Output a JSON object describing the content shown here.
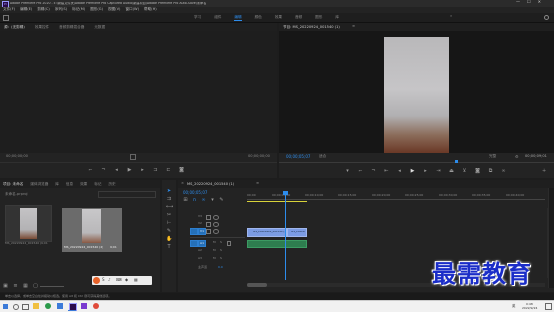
{
  "app": {
    "window_title": "Adobe Premiere Pro 2020 - E:\\新建文件夹\\Adobe Premiere Pro Captured Audio\\新建项目\\Adobe Premiere Pro Auto-Save\\未命名",
    "logo": "Pr",
    "window_controls": [
      "—",
      "☐",
      "✕"
    ]
  },
  "menu": [
    "文件(F)",
    "编辑(E)",
    "剪辑(C)",
    "序列(S)",
    "标记(M)",
    "图形(G)",
    "视图(V)",
    "窗口(W)",
    "帮助(H)"
  ],
  "workspaces": {
    "items": [
      "学习",
      "组件",
      "编辑",
      "颜色",
      "效果",
      "音频",
      "图形",
      "库"
    ],
    "active": "编辑"
  },
  "source_panel": {
    "tabs": [
      "源：(无剪辑)",
      "效果控件",
      "音频剪辑混合器",
      "元数据"
    ],
    "tc_left": "00;00;00;00",
    "tc_right": "00;00;00;00"
  },
  "program_panel": {
    "title": "节目: MS_20220924_001540 (1)",
    "timecode": "00;00;05;07",
    "fit": "适合",
    "quality": "完整",
    "duration": "00;00;09;01",
    "page": "1/2"
  },
  "project_panel": {
    "tabs": [
      "项目: 未命名",
      "媒体浏览器",
      "库",
      "信息",
      "效果",
      "标记",
      "历史"
    ],
    "folder": "未命名.prproj",
    "clips": [
      {
        "name": "MS_20220924_001540 (1)",
        "duration": "9;01",
        "selected": false
      },
      {
        "name": "MS_20220924_001540 (2)",
        "duration": "9;01",
        "selected": true
      }
    ]
  },
  "timeline": {
    "tab": "MS_20220924_001540 (1)",
    "timecode": "00;00;05;07",
    "ruler": [
      "00;00",
      "00;00;05;00",
      "00;00;10;00",
      "00;00;15;00",
      "00;00;20;00",
      "00;00;25;00",
      "00;00;30;00",
      "00;00;35;00",
      "00;00;40;00"
    ],
    "video_tracks": [
      "V3",
      "V2",
      "V1"
    ],
    "audio_tracks": [
      "A1",
      "A2",
      "A3"
    ],
    "master": "主声道",
    "master_value": "0.0",
    "clips": {
      "video_a": "MS_20220924_001540 (1).mp4",
      "video_b": "MS_20220924_001540 (1).mp4"
    }
  },
  "status": {
    "message": "单击以选择，或单击空白处并拖动以框选。使用 Alt 和 Ctrl 键可获得其他选项。"
  },
  "watermark": "最需教育",
  "taskbar": {
    "time": "0:48",
    "date": "2022/9/24",
    "lang": "英"
  },
  "colors": {
    "accent": "#2d8ceb",
    "timeline_clip": "#7b9be3",
    "playhead": "#2d8ceb",
    "watermark": "#1a2dc8"
  }
}
